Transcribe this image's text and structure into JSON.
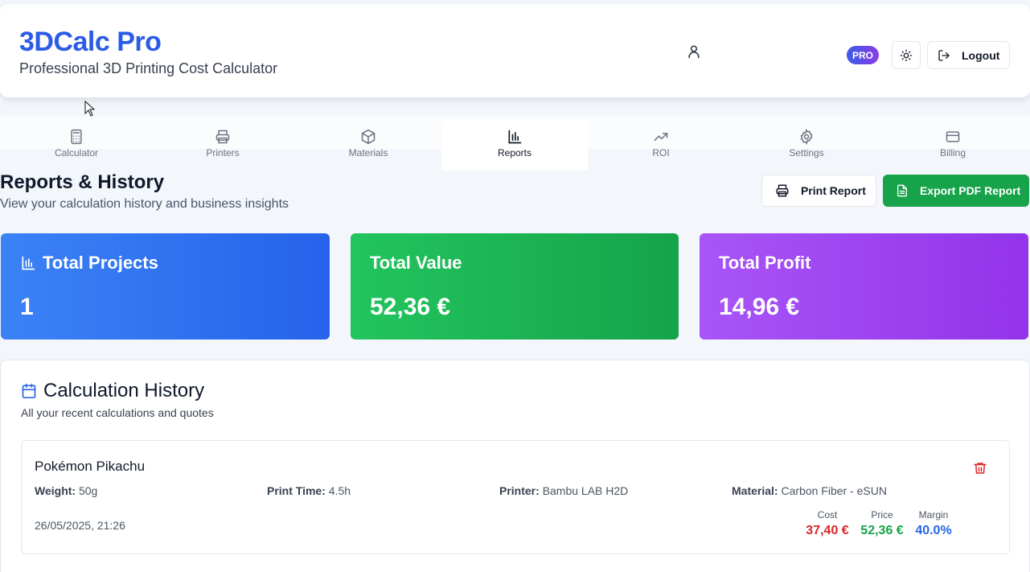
{
  "header": {
    "title": "3DCalc Pro",
    "subtitle": "Professional 3D Printing Cost Calculator",
    "pro_badge": "PRO",
    "logout_label": "Logout"
  },
  "tabs": [
    {
      "label": "Calculator",
      "icon": "calculator-icon"
    },
    {
      "label": "Printers",
      "icon": "printer-icon"
    },
    {
      "label": "Materials",
      "icon": "box-icon"
    },
    {
      "label": "Reports",
      "icon": "bar-chart-icon",
      "active": true
    },
    {
      "label": "ROI",
      "icon": "trending-up-icon"
    },
    {
      "label": "Settings",
      "icon": "gear-icon"
    },
    {
      "label": "Billing",
      "icon": "credit-card-icon"
    }
  ],
  "page": {
    "title": "Reports & History",
    "subtitle": "View your calculation history and business insights",
    "print_label": "Print Report",
    "export_label": "Export PDF Report"
  },
  "stats": {
    "projects": {
      "label": "Total Projects",
      "value": "1"
    },
    "value": {
      "label": "Total Value",
      "value": "52,36 €"
    },
    "profit": {
      "label": "Total Profit",
      "value": "14,96 €"
    }
  },
  "history": {
    "title": "Calculation History",
    "subtitle": "All your recent calculations and quotes",
    "entries": [
      {
        "name": "Pokémon Pikachu",
        "weight_label": "Weight:",
        "weight": "50g",
        "time_label": "Print Time:",
        "time": "4.5h",
        "printer_label": "Printer:",
        "printer": "Bambu LAB H2D",
        "material_label": "Material:",
        "material": "Carbon Fiber - eSUN",
        "date": "26/05/2025, 21:26",
        "cost_label": "Cost",
        "cost": "37,40 €",
        "price_label": "Price",
        "price": "52,36 €",
        "margin_label": "Margin",
        "margin": "40.0%"
      }
    ]
  },
  "colors": {
    "brand": "#2b5ce6",
    "cost": "#dc2626",
    "price": "#16a34a",
    "margin": "#2563eb",
    "export": "#17a34a"
  }
}
